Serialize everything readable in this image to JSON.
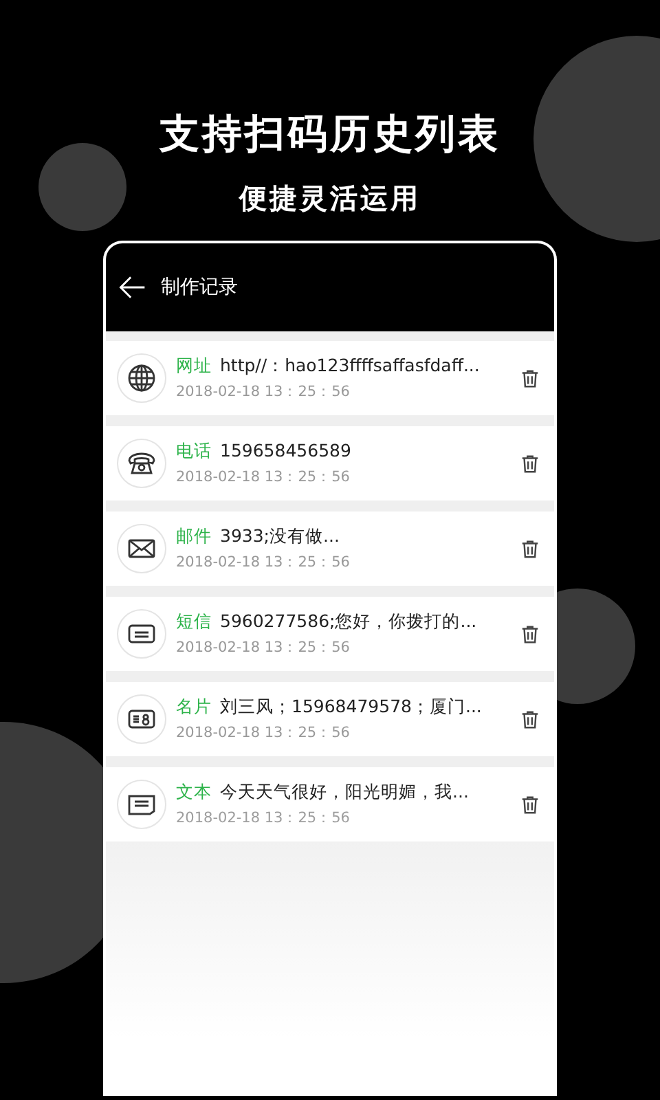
{
  "headline": "支持扫码历史列表",
  "subheadline": "便捷灵活运用",
  "screen": {
    "title": "制作记录",
    "records": [
      {
        "kind": "url",
        "type_label": "网址",
        "content": "http//：hao123ffffsaffasfdaff...",
        "time": "2018-02-18 13：25：56"
      },
      {
        "kind": "phone",
        "type_label": "电话",
        "content": "159658456589",
        "time": "2018-02-18 13：25：56"
      },
      {
        "kind": "email",
        "type_label": "邮件",
        "content": "3933;没有做...",
        "time": "2018-02-18 13：25：56"
      },
      {
        "kind": "sms",
        "type_label": "短信",
        "content": "5960277586;您好，你拨打的...",
        "time": "2018-02-18 13：25：56"
      },
      {
        "kind": "card",
        "type_label": "名片",
        "content": "刘三风；15968479578；厦门...",
        "time": "2018-02-18 13：25：56"
      },
      {
        "kind": "text",
        "type_label": "文本",
        "content": "今天天气很好，阳光明媚，我...",
        "time": "2018-02-18 13：25：56"
      }
    ]
  }
}
